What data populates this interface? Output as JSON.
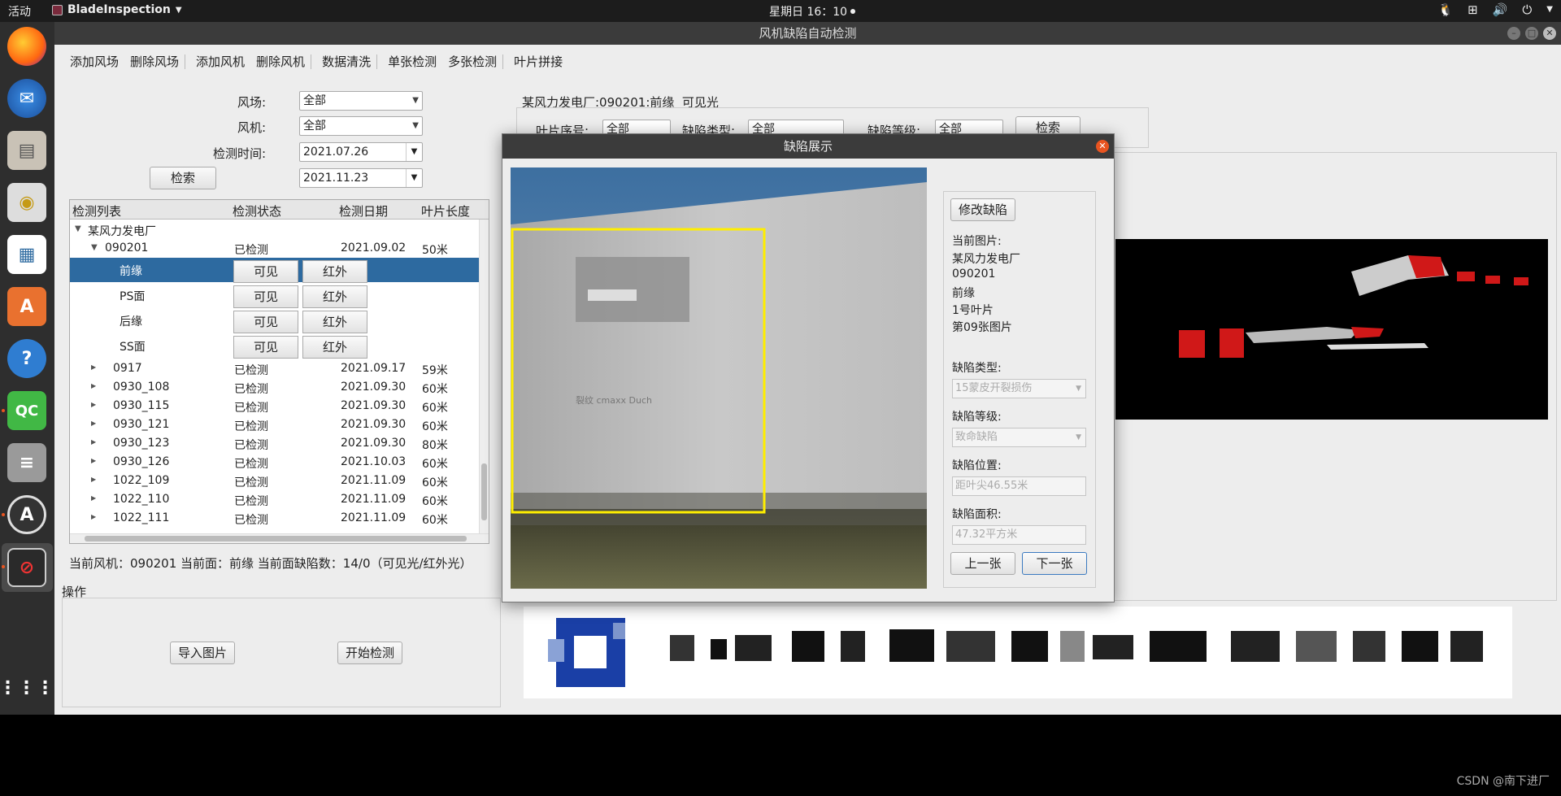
{
  "topbar": {
    "activities": "活动",
    "app_name": "BladeInspection",
    "clock": "星期日 16：10"
  },
  "window": {
    "title": "风机缺陷自动检测"
  },
  "menu": {
    "items": [
      "添加风场",
      "删除风场",
      "添加风机",
      "删除风机",
      "数据清洗",
      "单张检测",
      "多张检测",
      "叶片拼接"
    ]
  },
  "filter": {
    "farm_label": "风场:",
    "farm_value": "全部",
    "turbine_label": "风机:",
    "turbine_value": "全部",
    "time_label": "检测时间:",
    "date_from": "2021.07.26",
    "date_to": "2021.11.23",
    "search_button": "检索"
  },
  "tree": {
    "headers": [
      "检测列表",
      "检测状态",
      "检测日期",
      "叶片长度"
    ],
    "root": "某风力发电厂",
    "expanded": {
      "name": "090201",
      "status": "已检测",
      "date": "2021.09.02",
      "length": "50米"
    },
    "faces": [
      {
        "name": "前缘",
        "visible": "可见",
        "infrared": "红外"
      },
      {
        "name": "PS面",
        "visible": "可见",
        "infrared": "红外"
      },
      {
        "name": "后缘",
        "visible": "可见",
        "infrared": "红外"
      },
      {
        "name": "SS面",
        "visible": "可见",
        "infrared": "红外"
      }
    ],
    "rows": [
      {
        "name": "0917",
        "status": "已检测",
        "date": "2021.09.17",
        "length": "59米"
      },
      {
        "name": "0930_108",
        "status": "已检测",
        "date": "2021.09.30",
        "length": "60米"
      },
      {
        "name": "0930_115",
        "status": "已检测",
        "date": "2021.09.30",
        "length": "60米"
      },
      {
        "name": "0930_121",
        "status": "已检测",
        "date": "2021.09.30",
        "length": "60米"
      },
      {
        "name": "0930_123",
        "status": "已检测",
        "date": "2021.09.30",
        "length": "80米"
      },
      {
        "name": "0930_126",
        "status": "已检测",
        "date": "2021.10.03",
        "length": "60米"
      },
      {
        "name": "1022_109",
        "status": "已检测",
        "date": "2021.11.09",
        "length": "60米"
      },
      {
        "name": "1022_110",
        "status": "已检测",
        "date": "2021.11.09",
        "length": "60米"
      },
      {
        "name": "1022_111",
        "status": "已检测",
        "date": "2021.11.09",
        "length": "60米"
      }
    ]
  },
  "status_line": "当前风机：090201 当前面：前缘 当前面缺陷数：14/0（可见光/红外光）",
  "operations": {
    "title": "操作",
    "import_button": "导入图片",
    "start_button": "开始检测"
  },
  "right_panel": {
    "heading": "某风力发电厂:090201:前缘  可见光",
    "blade_no_label": "叶片序号:",
    "blade_no_value": "全部",
    "defect_type_label": "缺陷类型:",
    "defect_type_value": "全部",
    "defect_level_label": "缺陷等级:",
    "defect_level_value": "全部",
    "search_button": "检索"
  },
  "dialog": {
    "title": "缺陷展示",
    "modify_button": "修改缺陷",
    "current_label": "当前图片:",
    "info_lines": [
      "某风力发电厂",
      "090201",
      "前缘",
      "1号叶片",
      "第09张图片"
    ],
    "type_label": "缺陷类型:",
    "type_value": "15蒙皮开裂损伤",
    "level_label": "缺陷等级:",
    "level_value": "致命缺陷",
    "position_label": "缺陷位置:",
    "position_value": "距叶尖46.55米",
    "area_label": "缺陷面积:",
    "area_value": "47.32平方米",
    "prev_button": "上一张",
    "next_button": "下一张",
    "image_scribble": "裂纹 cmaxx Duch"
  },
  "watermark": "CSDN @南下进厂",
  "colors": {
    "selection": "#2d6aa0",
    "accent": "#e95420",
    "bbox": "#ffee00"
  }
}
